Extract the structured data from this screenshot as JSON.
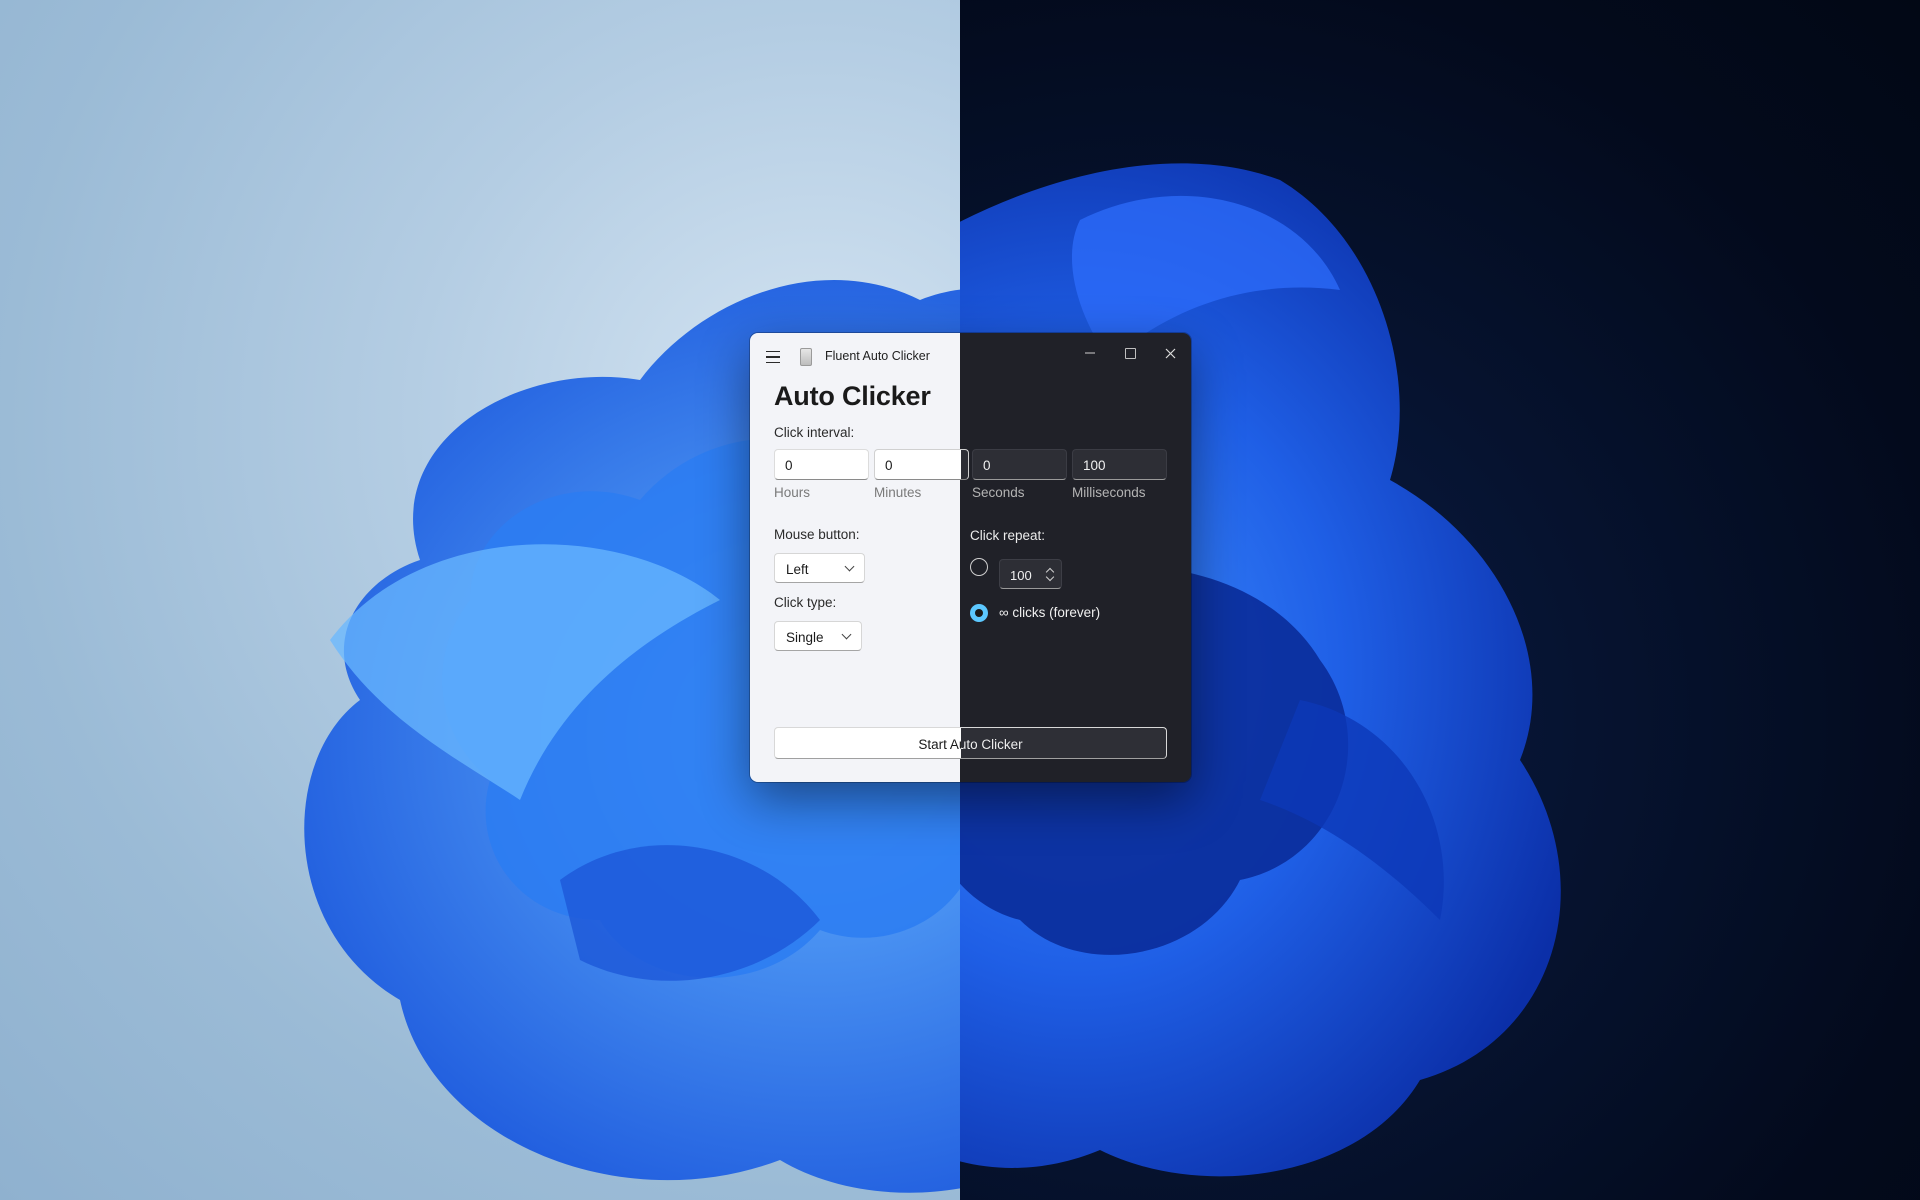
{
  "window": {
    "title": "Fluent Auto Clicker",
    "controls": [
      "minimize",
      "maximize",
      "close"
    ]
  },
  "page": {
    "heading": "Auto Clicker"
  },
  "click_interval": {
    "label": "Click interval:",
    "fields": [
      {
        "value": "0",
        "caption": "Hours"
      },
      {
        "value": "0",
        "caption": "Minutes"
      },
      {
        "value": "0",
        "caption": "Seconds"
      },
      {
        "value": "100",
        "caption": "Milliseconds"
      }
    ]
  },
  "mouse_button": {
    "label": "Mouse button:",
    "selected": "Left"
  },
  "click_type": {
    "label": "Click type:",
    "selected": "Single"
  },
  "click_repeat": {
    "label": "Click repeat:",
    "options": [
      {
        "kind": "count",
        "value": "100",
        "selected": false
      },
      {
        "kind": "forever",
        "text": "∞ clicks (forever)",
        "selected": true
      }
    ]
  },
  "start_button": {
    "label": "Start Auto Clicker"
  },
  "icons": [
    "hamburger-menu-icon",
    "app-icon",
    "minimize-icon",
    "maximize-icon",
    "close-icon",
    "chevron-down-icon",
    "spinner-icon"
  ],
  "colors": {
    "accent": "#5cc8ff",
    "light_surface": "#f3f4f8",
    "dark_surface": "#202128"
  }
}
